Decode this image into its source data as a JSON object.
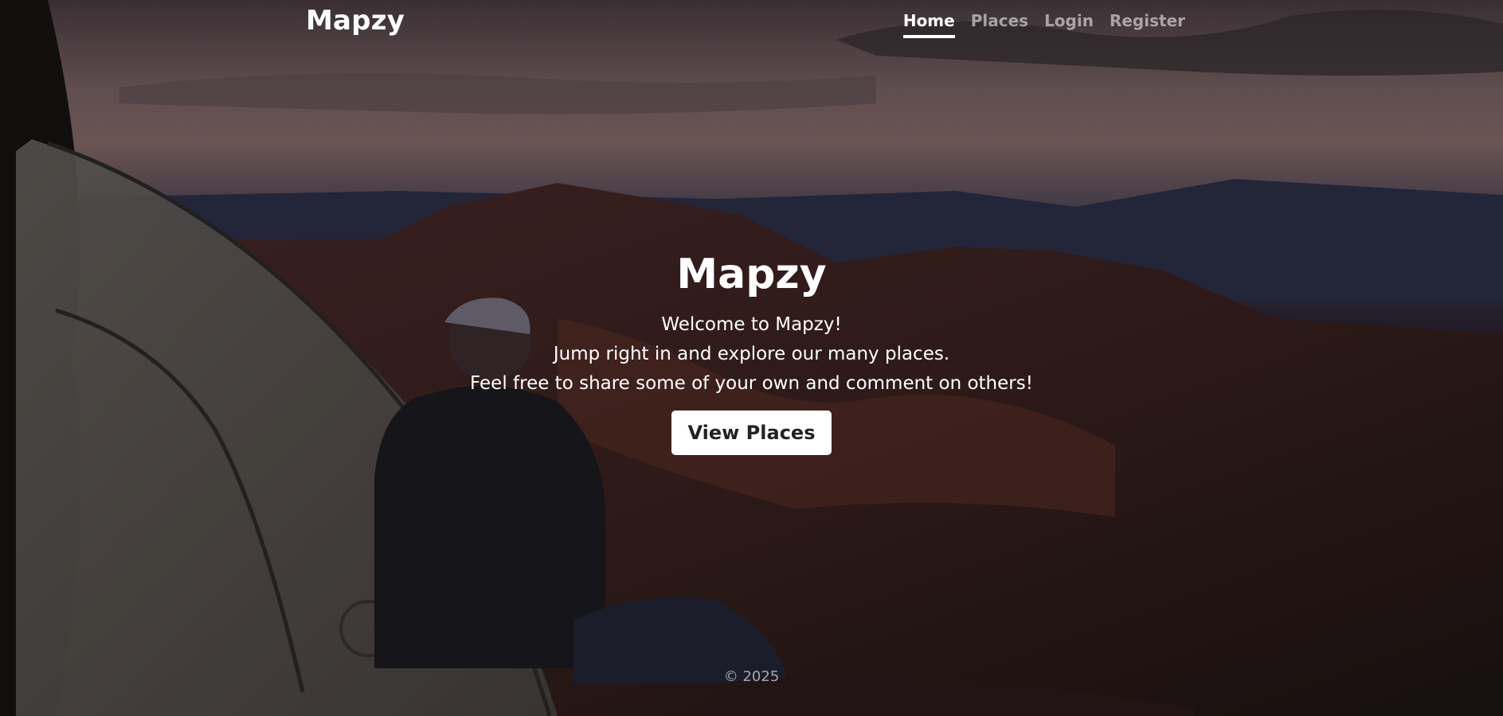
{
  "navbar": {
    "brand": "Mapzy",
    "links": [
      {
        "label": "Home",
        "active": true
      },
      {
        "label": "Places",
        "active": false
      },
      {
        "label": "Login",
        "active": false
      },
      {
        "label": "Register",
        "active": false
      }
    ]
  },
  "hero": {
    "title": "Mapzy",
    "lines": [
      "Welcome to Mapzy!",
      "Jump right in and explore our many places.",
      "Feel free to share some of your own and comment on others!"
    ],
    "button_label": "View Places"
  },
  "footer": {
    "text": "© 2025"
  },
  "colors": {
    "overlay": "#000000",
    "button_bg": "#ffffff",
    "button_text": "#222222"
  }
}
